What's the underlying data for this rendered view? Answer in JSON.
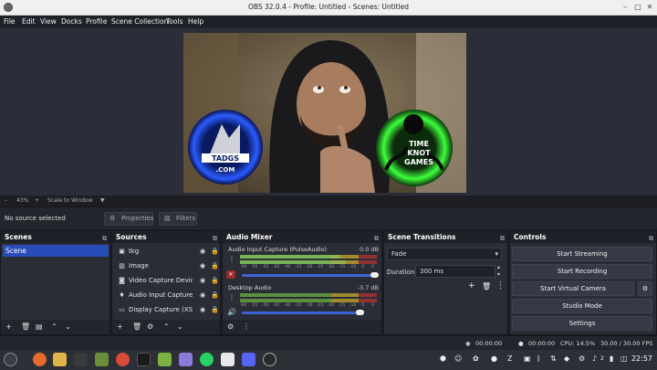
{
  "window": {
    "title": "OBS 32.0.4 - Profile: Untitled - Scenes: Untitled"
  },
  "menu": [
    "File",
    "Edit",
    "View",
    "Docks",
    "Profile",
    "Scene Collection",
    "Tools",
    "Help"
  ],
  "preview": {
    "zoom_label": "43%",
    "scale_mode": "Scale to Window"
  },
  "source_bar": {
    "status": "No source selected",
    "properties_label": "Properties",
    "filters_label": "Filters"
  },
  "scenes": {
    "title": "Scenes",
    "items": [
      "Scene"
    ]
  },
  "sources": {
    "title": "Sources",
    "items": [
      {
        "name": "tkg",
        "icon": "window-capture-icon"
      },
      {
        "name": "Image",
        "icon": "image-icon"
      },
      {
        "name": "Video Capture Device",
        "icon": "camera-icon"
      },
      {
        "name": "Audio Input Capture (P",
        "icon": "microphone-icon"
      },
      {
        "name": "Display Capture (XSHM",
        "icon": "monitor-icon"
      }
    ]
  },
  "audio_mixer": {
    "title": "Audio Mixer",
    "channels": [
      {
        "name": "Audio Input Capture (PulseAudio)",
        "db": "0.0 dB",
        "muted": true,
        "volume": 1.0
      },
      {
        "name": "Desktop Audio",
        "db": "-3.7 dB",
        "muted": false,
        "volume": 0.88
      }
    ],
    "scale_ticks": [
      "-60",
      "-55",
      "-50",
      "-45",
      "-40",
      "-35",
      "-30",
      "-25",
      "-20",
      "-15",
      "-10",
      "-5",
      "0"
    ]
  },
  "transitions": {
    "title": "Scene Transitions",
    "selected": "Fade",
    "duration_label": "Duration",
    "duration_value": "300 ms"
  },
  "controls": {
    "title": "Controls",
    "start_streaming": "Start Streaming",
    "start_recording": "Start Recording",
    "start_virtual_camera": "Start Virtual Camera",
    "studio_mode": "Studio Mode",
    "settings": "Settings"
  },
  "status": {
    "stream_time": "00:00:00",
    "record_time": "00:00:00",
    "cpu": "CPU: 14.5%",
    "fps": "30.00 / 30.00 FPS"
  },
  "canvas_text": {
    "left_logo_top": "TADGS",
    "left_logo_bottom": ".COM",
    "right_logo_1": "TIME",
    "right_logo_2": "KNOT",
    "right_logo_3": "GAMES"
  },
  "taskbar": {
    "clock": "22:57",
    "volume_level": "2"
  },
  "colors": {
    "accent": "#284cb8",
    "panel": "#2a2d35",
    "window_bg": "#1d1f26"
  }
}
